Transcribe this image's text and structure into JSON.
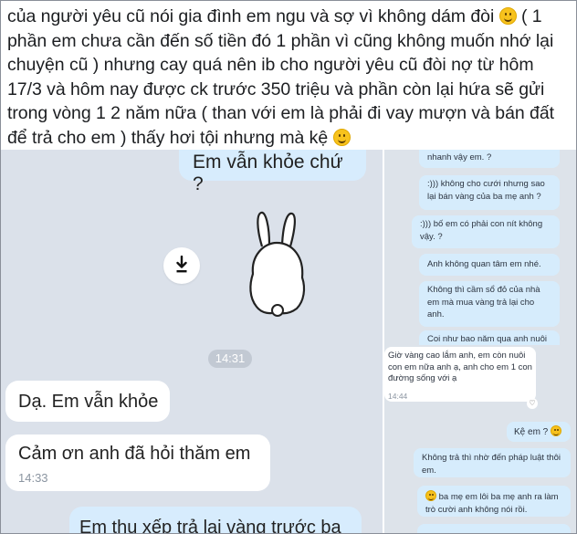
{
  "caption": {
    "lines": [
      "của người yêu cũ nói gia đình em ngu và sợ vì không dám đòi",
      "phần em chưa cần đến số tiền đó 1 phần vì cũng không muốn nhớ lại",
      "chuyện cũ ) nhưng cay quá nên ib cho người yêu cũ đòi nợ từ hôm",
      "17/3 và hôm nay được ck trước 350 triệu và phần còn lại hứa sẽ gửi",
      "trong vòng 1 2 năm nữa ( than với em là phải đi vay mượn và bán đất",
      "để trả cho em ) thấy hơi tội nhưng mà kệ"
    ],
    "line1_tail": "( 1",
    "emoji_icon": "slightly-smiling-face-icon"
  },
  "left_chat": {
    "sent_top": "Em vẫn khỏe chứ ?",
    "sticker_icon": "white-bunny-sticker",
    "download_icon": "download-arrow-icon",
    "time_pill": "14:31",
    "reply1": "Dạ. Em vẫn khỏe",
    "reply2": "Cảm ơn anh đã hỏi thăm em",
    "reply2_time": "14:33",
    "sent_bottom": "Em thu xếp trả lại vàng trước ba"
  },
  "right_top_chat": {
    "messages": [
      "nhanh vậy em. ?",
      ":))) không cho cưới nhưng sao lại bán vàng của ba mẹ anh ?",
      ":))) bố em có phải con nít không vậy. ?",
      "Anh không quan tâm em nhé.",
      "Không thì cầm sổ đỏ của nhà em mà mua vàng trả lại cho anh.",
      "Coi như bao năm qua anh nuôi"
    ]
  },
  "right_bottom_chat": {
    "received": "Giờ vàng cao lắm anh, em còn nuôi con em nữa anh ạ, anh cho em 1 con đường sống với ạ",
    "received_time": "14:44",
    "heart_icon": "heart-reaction-icon",
    "sent1": "Kệ em ?",
    "sent2": "Không trả thì nhờ đến pháp luật thôi em.",
    "sent3": "ba mẹ em lôi ba mẹ anh ra làm trò cười anh không nói rồi.",
    "sent4": "..."
  },
  "colors": {
    "chat_bg": "#dbe1ea",
    "sent_bubble": "#d7ecfd",
    "received_bubble": "#ffffff",
    "emoji_yellow": "#f7c21d"
  }
}
